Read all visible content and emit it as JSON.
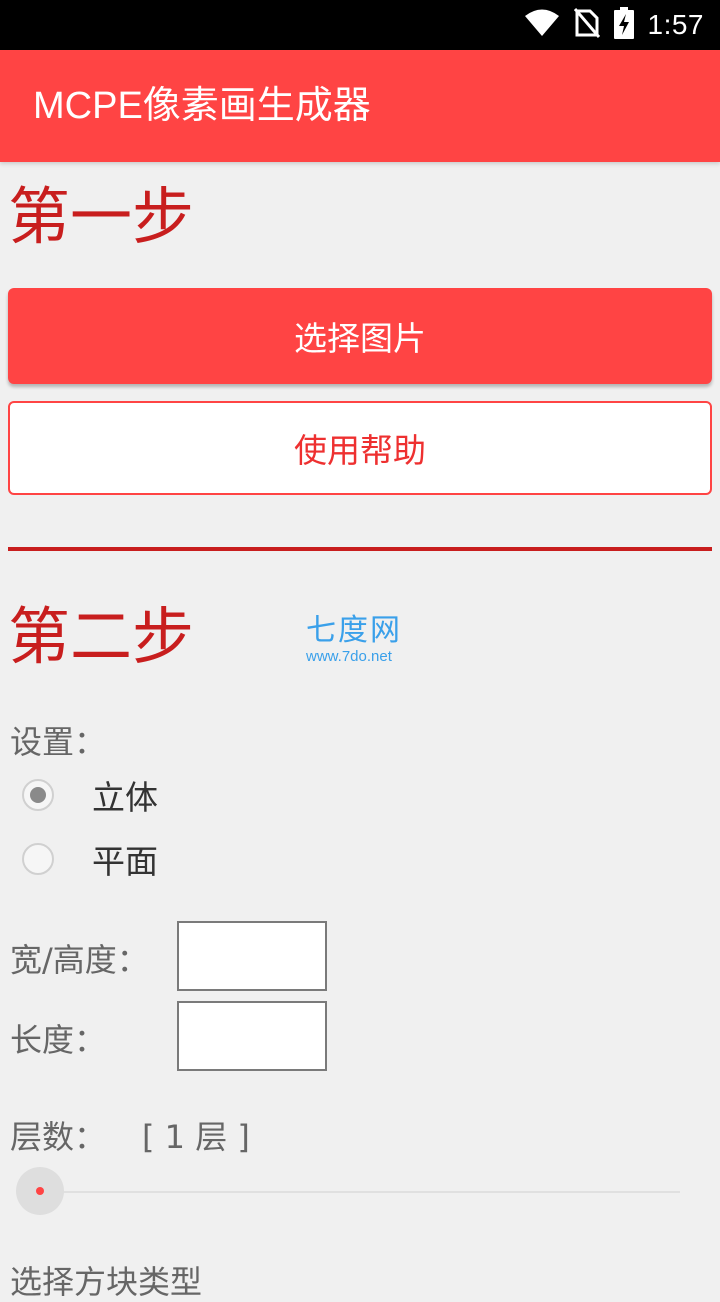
{
  "status_bar": {
    "time": "1:57",
    "icons": [
      "wifi-icon",
      "no-sim-icon",
      "battery-charging-icon"
    ]
  },
  "app_bar": {
    "title": "MCPE像素画生成器",
    "color": "#ff4444"
  },
  "step1": {
    "title": "第一步",
    "select_image_label": "选择图片",
    "help_label": "使用帮助"
  },
  "step2": {
    "title": "第二步",
    "settings_label": "设置：",
    "mode_options": [
      {
        "label": "立体",
        "checked": true
      },
      {
        "label": "平面",
        "checked": false
      }
    ],
    "width_height_label": "宽/高度：",
    "width_height_value": "",
    "length_label": "长度：",
    "length_value": "",
    "layers_label": "层数：",
    "layers_value": "[ 1 层 ]",
    "slider_value": 0,
    "block_type_label": "选择方块类型"
  },
  "watermark": {
    "title": "七度网",
    "url": "www.7do.net"
  },
  "colors": {
    "accent": "#ff4444",
    "step_title": "#c81e1e",
    "watermark": "#3aa0ea"
  }
}
